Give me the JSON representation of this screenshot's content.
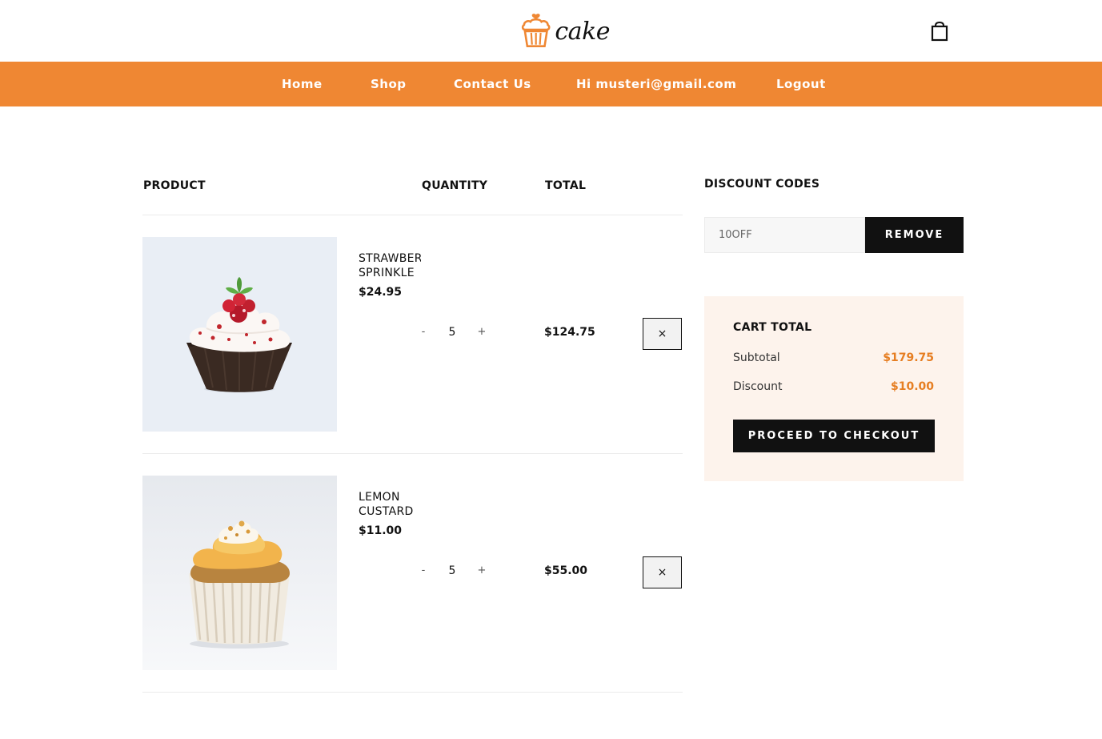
{
  "header": {
    "logo_text": "cake",
    "logo_icon": "cupcake-icon",
    "cart_icon": "shopping-bag-icon"
  },
  "nav": {
    "items": [
      {
        "label": "Home"
      },
      {
        "label": "Shop"
      },
      {
        "label": "Contact Us"
      },
      {
        "label": "Hi musteri@gmail.com"
      },
      {
        "label": "Logout"
      }
    ]
  },
  "cart_table": {
    "headers": {
      "product": "PRODUCT",
      "quantity": "QUANTITY",
      "total": "TOTAL"
    },
    "items": [
      {
        "name_line1": "STRAWBERRY",
        "name_line2": "SPRINKLE",
        "price": "$24.95",
        "quantity": "5",
        "minus": "-",
        "plus": "+",
        "total": "$124.75",
        "remove": "×",
        "image": "red-velvet-cupcake"
      },
      {
        "name_line1": "LEMON",
        "name_line2": "CUSTARD",
        "price": "$11.00",
        "quantity": "5",
        "minus": "-",
        "plus": "+",
        "total": "$55.00",
        "remove": "×",
        "image": "lemon-cupcake"
      }
    ]
  },
  "discount": {
    "title": "DISCOUNT CODES",
    "code_value": "10OFF",
    "button_label": "REMOVE"
  },
  "cart_total": {
    "title": "CART TOTAL",
    "subtotal_label": "Subtotal",
    "subtotal_value": "$179.75",
    "discount_label": "Discount",
    "discount_value": "$10.00",
    "checkout_label": "PROCEED TO CHECKOUT"
  },
  "colors": {
    "accent": "#ef8733",
    "price_accent": "#e67e22",
    "cart_box_bg": "#fdf3ec",
    "button_dark": "#111111"
  }
}
